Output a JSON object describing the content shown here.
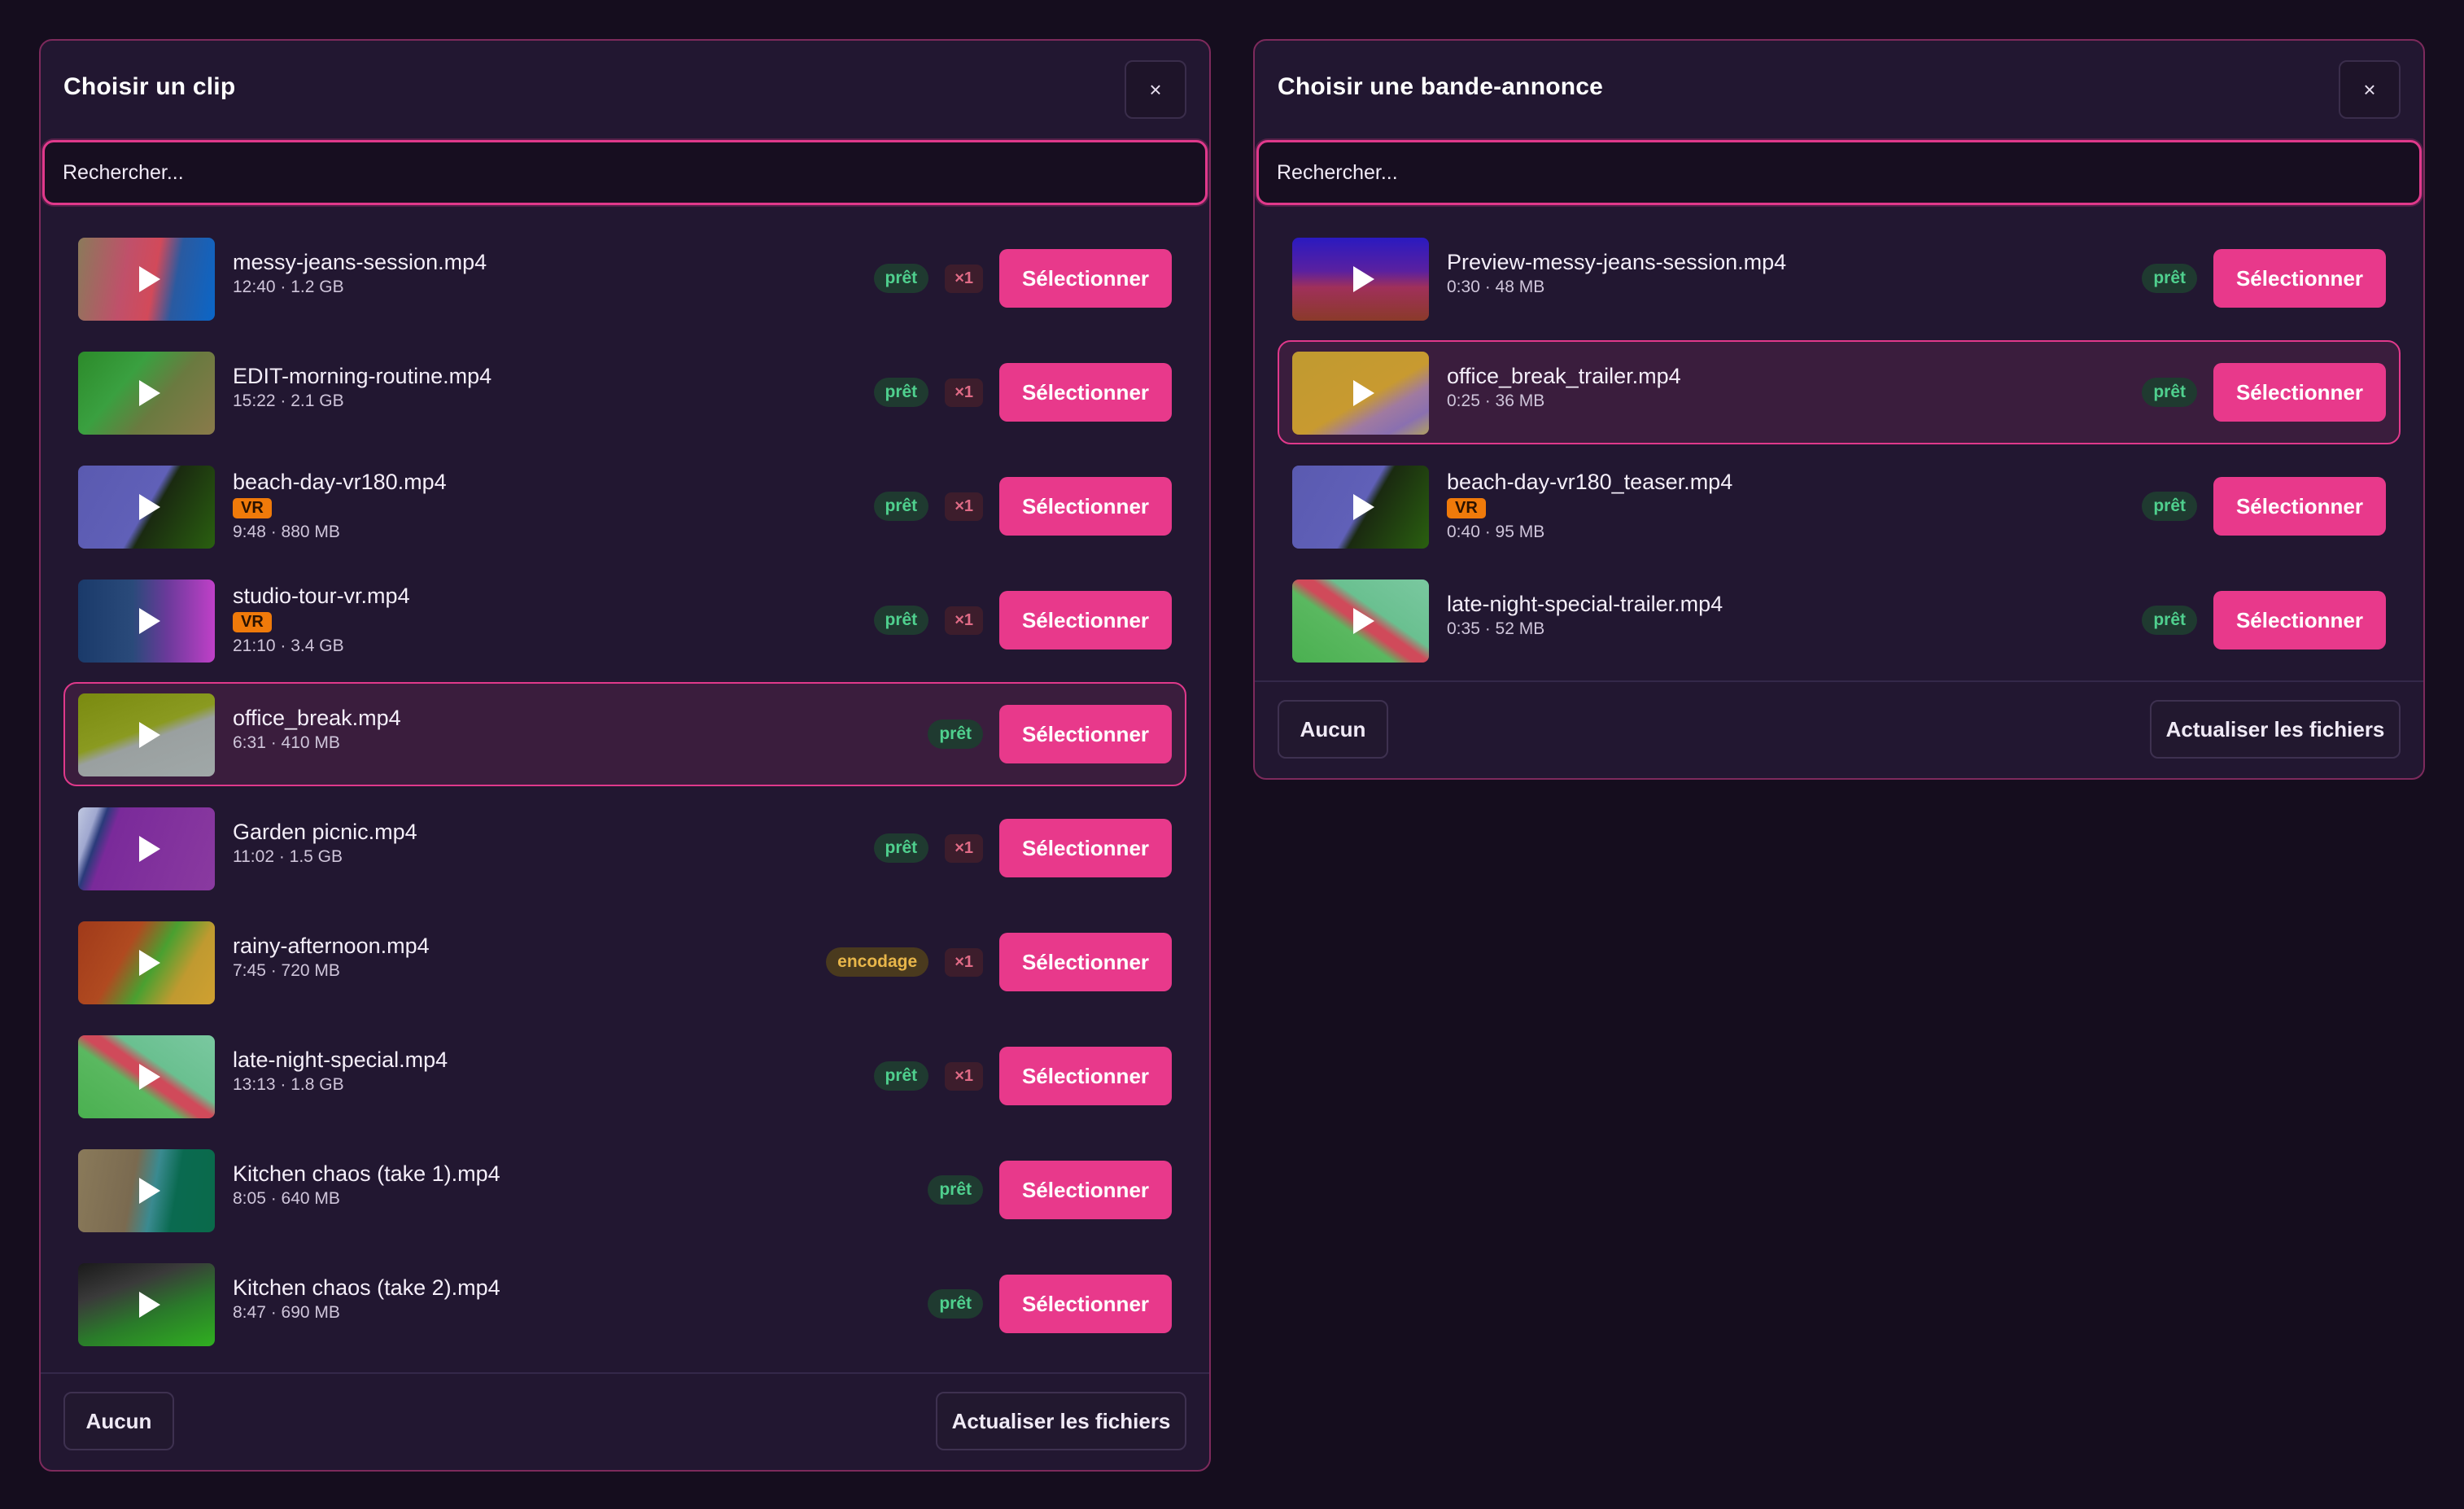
{
  "clip_dialog": {
    "title": "Choisir un clip",
    "close_label": "×",
    "search_placeholder": "Rechercher...",
    "items": [
      {
        "name": "messy-jeans-session.mp4",
        "meta": "12:40 · 1.2 GB",
        "vr": "",
        "status": "prêt",
        "count": "×1",
        "select": "Sélectionner"
      },
      {
        "name": "EDIT-morning-routine.mp4",
        "meta": "15:22 · 2.1 GB",
        "vr": "",
        "status": "prêt",
        "count": "×1",
        "select": "Sélectionner"
      },
      {
        "name": "beach-day-vr180.mp4",
        "meta": "9:48 · 880 MB",
        "vr": "VR",
        "status": "prêt",
        "count": "×1",
        "select": "Sélectionner"
      },
      {
        "name": "studio-tour-vr.mp4",
        "meta": "21:10 · 3.4 GB",
        "vr": "VR",
        "status": "prêt",
        "count": "×1",
        "select": "Sélectionner"
      },
      {
        "name": "office_break.mp4",
        "meta": "6:31 · 410 MB",
        "vr": "",
        "status": "prêt",
        "count": "",
        "select": "Sélectionner"
      },
      {
        "name": "Garden picnic.mp4",
        "meta": "11:02 · 1.5 GB",
        "vr": "",
        "status": "prêt",
        "count": "×1",
        "select": "Sélectionner"
      },
      {
        "name": "rainy-afternoon.mp4",
        "meta": "7:45 · 720 MB",
        "vr": "",
        "status": "encodage",
        "count": "×1",
        "select": "Sélectionner"
      },
      {
        "name": "late-night-special.mp4",
        "meta": "13:13 · 1.8 GB",
        "vr": "",
        "status": "prêt",
        "count": "×1",
        "select": "Sélectionner"
      },
      {
        "name": "Kitchen chaos (take 1).mp4",
        "meta": "8:05 · 640 MB",
        "vr": "",
        "status": "prêt",
        "count": "",
        "select": "Sélectionner"
      },
      {
        "name": "Kitchen chaos (take 2).mp4",
        "meta": "8:47 · 690 MB",
        "vr": "",
        "status": "prêt",
        "count": "",
        "select": "Sélectionner"
      }
    ],
    "none_label": "Aucun",
    "refresh_label": "Actualiser les fichiers"
  },
  "trailer_dialog": {
    "title": "Choisir une bande-annonce",
    "close_label": "×",
    "search_placeholder": "Rechercher...",
    "items": [
      {
        "name": "Preview-messy-jeans-session.mp4",
        "meta": "0:30 · 48 MB",
        "vr": "",
        "status": "prêt",
        "select": "Sélectionner"
      },
      {
        "name": "office_break_trailer.mp4",
        "meta": "0:25 · 36 MB",
        "vr": "",
        "status": "prêt",
        "select": "Sélectionner"
      },
      {
        "name": "beach-day-vr180_teaser.mp4",
        "meta": "0:40 · 95 MB",
        "vr": "VR",
        "status": "prêt",
        "select": "Sélectionner"
      },
      {
        "name": "late-night-special-trailer.mp4",
        "meta": "0:35 · 52 MB",
        "vr": "",
        "status": "prêt",
        "select": "Sélectionner"
      }
    ],
    "none_label": "Aucun",
    "refresh_label": "Actualiser les fichiers"
  },
  "colors": {
    "accent": "#e8398b",
    "ready": "#4fd08e",
    "encoding": "#e8b64a",
    "vr": "#f07a0a"
  }
}
